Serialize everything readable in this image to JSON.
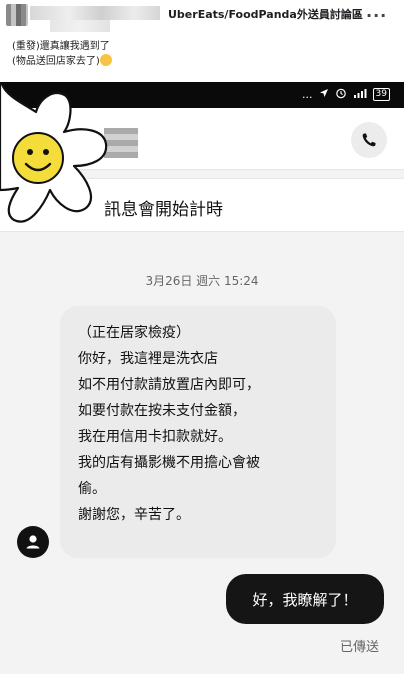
{
  "post": {
    "group_name": "UberEats/FoodPanda外送員討論區",
    "more_label": "...",
    "text_line_1": "(重發)還真讓我遇到了",
    "text_line_2": "(物品送回店家去了)"
  },
  "statusbar": {
    "dots": "...",
    "battery": "39"
  },
  "chat": {
    "banner": "訊息會開始計時",
    "date": "3月26日 週六 15:24",
    "incoming_lines": [
      "（正在居家檢疫）",
      "你好，我這裡是洗衣店",
      "如不用付款請放置店內即可，",
      "如要付款在按未支付金額，",
      "我在用信用卡扣款就好。",
      "我的店有攝影機不用擔心會被",
      "偷。",
      "謝謝您，辛苦了。"
    ],
    "outgoing": "好，我瞭解了！",
    "sent_status": "已傳送"
  },
  "colors": {
    "status_bar": "#0a0a0a",
    "bubble_in": "#ebebeb",
    "bubble_out": "#151515",
    "flower_face": "#f4dc3a"
  },
  "icons": [
    "more-icon",
    "navigation-arrow-icon",
    "alarm-icon",
    "signal-icon",
    "battery-icon",
    "phone-icon",
    "user-avatar-icon",
    "flower-sticker"
  ]
}
